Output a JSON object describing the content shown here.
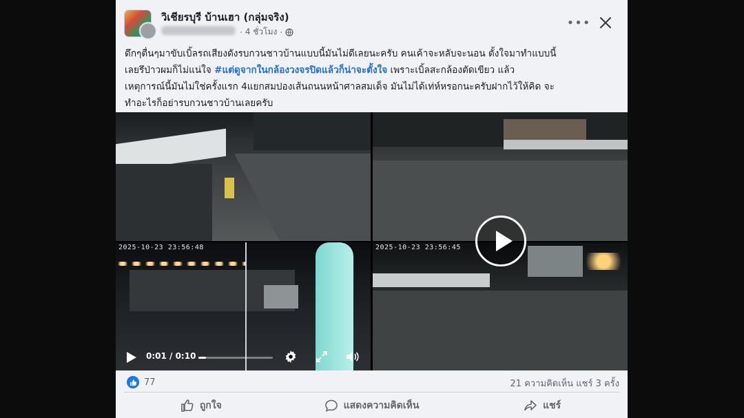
{
  "post": {
    "group_name": "วิเชียรบุรี บ้านเฮา (กลุ่มจริง)",
    "time": "4 ชั่วโมง",
    "text_lines": [
      "ดึกๆตื่นๆมาขับเบิ้ลรถเสียงดังรบกวนชาวบ้านแบบนี้มันไม่ดีเลยนะครับ คนเค้าจะหลับจะนอน ตั้งใจมาทำแบบนี้",
      "เพราะเบิ้ลสะกล้องตัดเขียว แล้ว",
      "เหตุการณ์นี้มันไม่ใช่ครั้งแรก 4แยกสมปองเส้นถนนหน้าศาลสมเด็จ มันไม่ได้เท่ห์หรอกนะครับฝากไว้ให้คิด จะ",
      "ทำอะไรก็อย่ารบกวนชาวบ้านเลยครับ"
    ],
    "line2_prefix": "เลยรึป่าวผมก็ไม่แน่ใจ ",
    "hashtag": "#แต่ดูจากในกล้องวงจรปิดแล้วก็น่าจะตั้งใจ",
    "hashtag_color": "#216fdb"
  },
  "video": {
    "timestamp_left": "2025-10-23 23:56:48",
    "timestamp_right": "2025-10-23 23:56:45",
    "time_display": "0:01 / 0:10",
    "progress": 0.1
  },
  "footer": {
    "like_count": "77",
    "comments": "21 ความคิดเห็น",
    "shares": "แชร์ 3 ครั้ง",
    "like_label": "ถูกใจ",
    "comment_label": "แสดงความคิดเห็น",
    "share_label": "แชร์"
  },
  "colors": {
    "accent": "#1877f2",
    "text_secondary": "#606770",
    "card_bg": "#f0f2f5"
  },
  "icons": [
    "globe-icon",
    "more-options-icon",
    "close-icon",
    "play-icon",
    "settings-icon",
    "fullscreen-icon",
    "volume-icon",
    "like-icon",
    "comment-icon",
    "share-icon"
  ]
}
